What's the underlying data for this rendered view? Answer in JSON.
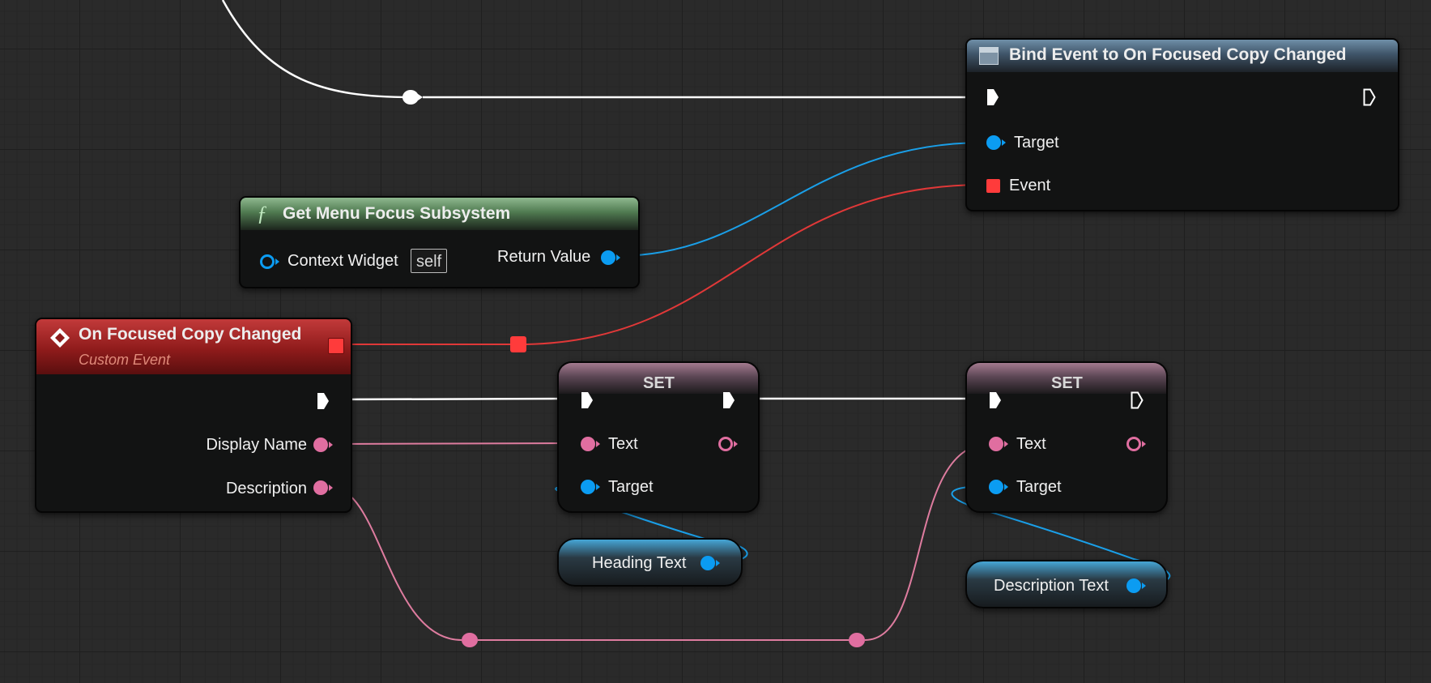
{
  "nodes": {
    "bind_event": {
      "title": "Bind Event to On Focused Copy Changed",
      "pins": {
        "target": "Target",
        "event": "Event"
      }
    },
    "get_menu_focus": {
      "title": "Get Menu Focus Subsystem",
      "icon_glyph": "ƒ",
      "pins": {
        "context_widget": "Context Widget",
        "context_value": "self",
        "return_value": "Return Value"
      }
    },
    "custom_event": {
      "title": "On Focused Copy Changed",
      "subtitle": "Custom Event",
      "pins": {
        "display_name": "Display Name",
        "description": "Description"
      }
    },
    "set_heading": {
      "title": "SET",
      "pins": {
        "text": "Text",
        "target": "Target"
      }
    },
    "set_description": {
      "title": "SET",
      "pins": {
        "text": "Text",
        "target": "Target"
      }
    },
    "heading_var": {
      "label": "Heading Text"
    },
    "description_var": {
      "label": "Description Text"
    }
  },
  "colors": {
    "exec_wire": "#ffffff",
    "object_pin": "#0b9cf2",
    "text_pin": "#e06ea0",
    "delegate_pin": "#ff3b3b",
    "event_header": "#8f1b1b",
    "function_header": "#4d7a4d",
    "bind_header": "#4f6f87"
  },
  "icons": {
    "bind_node_icon": "window-icon",
    "function_icon": "function-icon",
    "event_icon": "event-diamond-icon"
  }
}
